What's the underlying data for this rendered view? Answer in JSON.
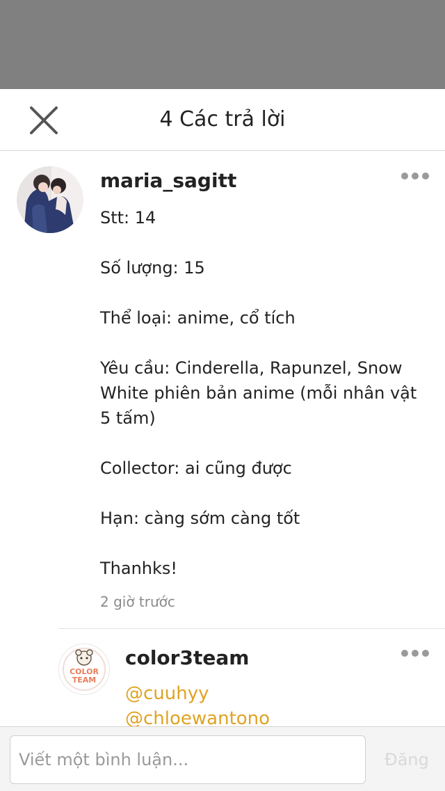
{
  "header": {
    "title": "4 Các trả lời"
  },
  "comment": {
    "username": "maria_sagitt",
    "body_lines": [
      "Stt: 14",
      "Số lượng: 15",
      "Thể loại: anime, cổ tích",
      "Yêu cầu: Cinderella, Rapunzel, Snow White phiên bản anime (mỗi nhân vật 5 tấm)",
      "Collector: ai cũng được",
      "Hạn: càng sớm càng tốt",
      "Thanhks!"
    ],
    "timestamp": "2 giờ trước"
  },
  "reply": {
    "username": "color3team",
    "avatar_text": [
      "COLOR",
      "TEAM"
    ],
    "mentions": [
      "@cuuhyy",
      "@chloewantono"
    ]
  },
  "footer": {
    "input_placeholder": "Viết một bình luận...",
    "post_label": "Đăng"
  },
  "colors": {
    "mention": "#e0a323",
    "overlay": "#808080",
    "timestamp": "#8a8a8a"
  },
  "icons": {
    "close": "close-icon",
    "more": "more-dots-icon"
  }
}
